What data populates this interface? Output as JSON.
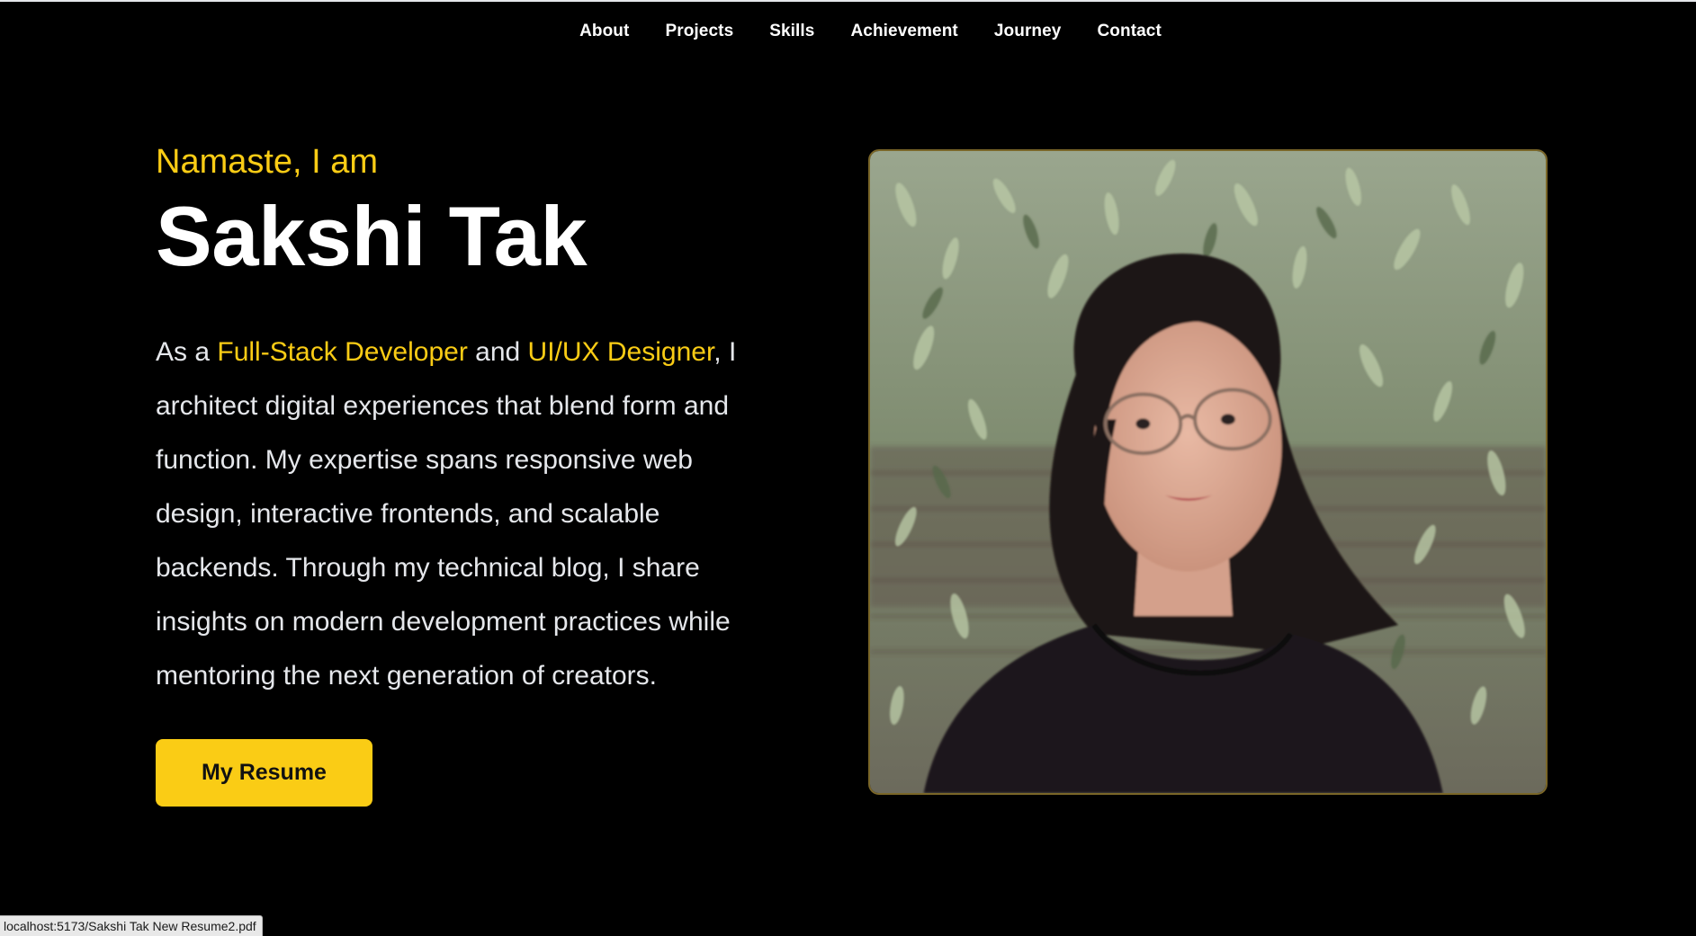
{
  "nav": {
    "items": [
      {
        "label": "About"
      },
      {
        "label": "Projects"
      },
      {
        "label": "Skills"
      },
      {
        "label": "Achievement"
      },
      {
        "label": "Journey"
      },
      {
        "label": "Contact"
      }
    ]
  },
  "hero": {
    "greeting": "Namaste, I am",
    "name": "Sakshi Tak",
    "bio": {
      "prefix": "As a ",
      "highlight_1": "Full-Stack Developer",
      "middle": " and ",
      "highlight_2": "UI/UX Designer",
      "suffix": ", I architect digital experiences that blend form and function. My expertise spans responsive web design, interactive frontends, and scalable backends. Through my technical blog, I share insights on modern development practices while mentoring the next generation of creators."
    },
    "resume_button_label": "My Resume"
  },
  "photo": {
    "icon": "profile-photo"
  },
  "status_bar": {
    "url": "localhost:5173/Sakshi Tak New Resume2.pdf"
  },
  "colors": {
    "background": "#000000",
    "accent": "#facc15",
    "text": "#ffffff",
    "body_text": "#e5e7eb"
  }
}
